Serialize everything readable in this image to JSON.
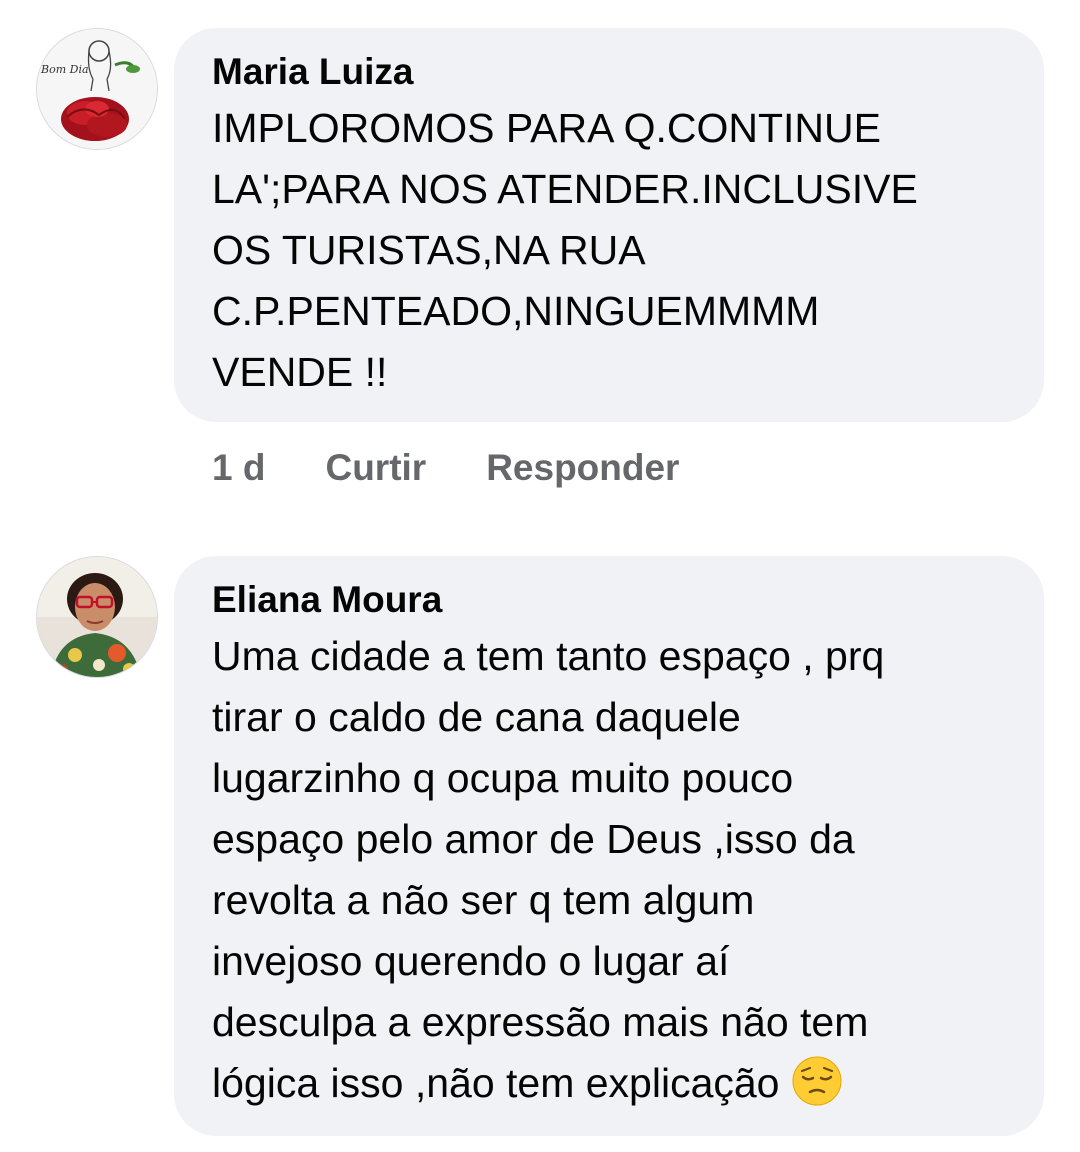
{
  "comments": [
    {
      "author": "Maria Luiza",
      "avatar_caption": "Bom Dia",
      "text": "IMPLOROMOS PARA Q.CONTINUE\nLA';PARA NOS ATENDER.INCLUSIVE\nOS TURISTAS,NA RUA\nC.P.PENTEADO,NINGUEMMMM\nVENDE !!",
      "time": "1 d",
      "like_label": "Curtir",
      "reply_label": "Responder"
    },
    {
      "author": "Eliana Moura",
      "text": "Uma cidade a tem tanto espaço , prq\ntirar o caldo de cana daquele\nlugarzinho q ocupa muito pouco\nespaço pelo amor de Deus ,isso da\nrevolta a não ser q tem algum\ninvejoso querendo o lugar aí\ndesculpa a expressão mais não tem\nlógica isso ,não tem explicação",
      "emoji": "pensive-face-icon"
    }
  ]
}
